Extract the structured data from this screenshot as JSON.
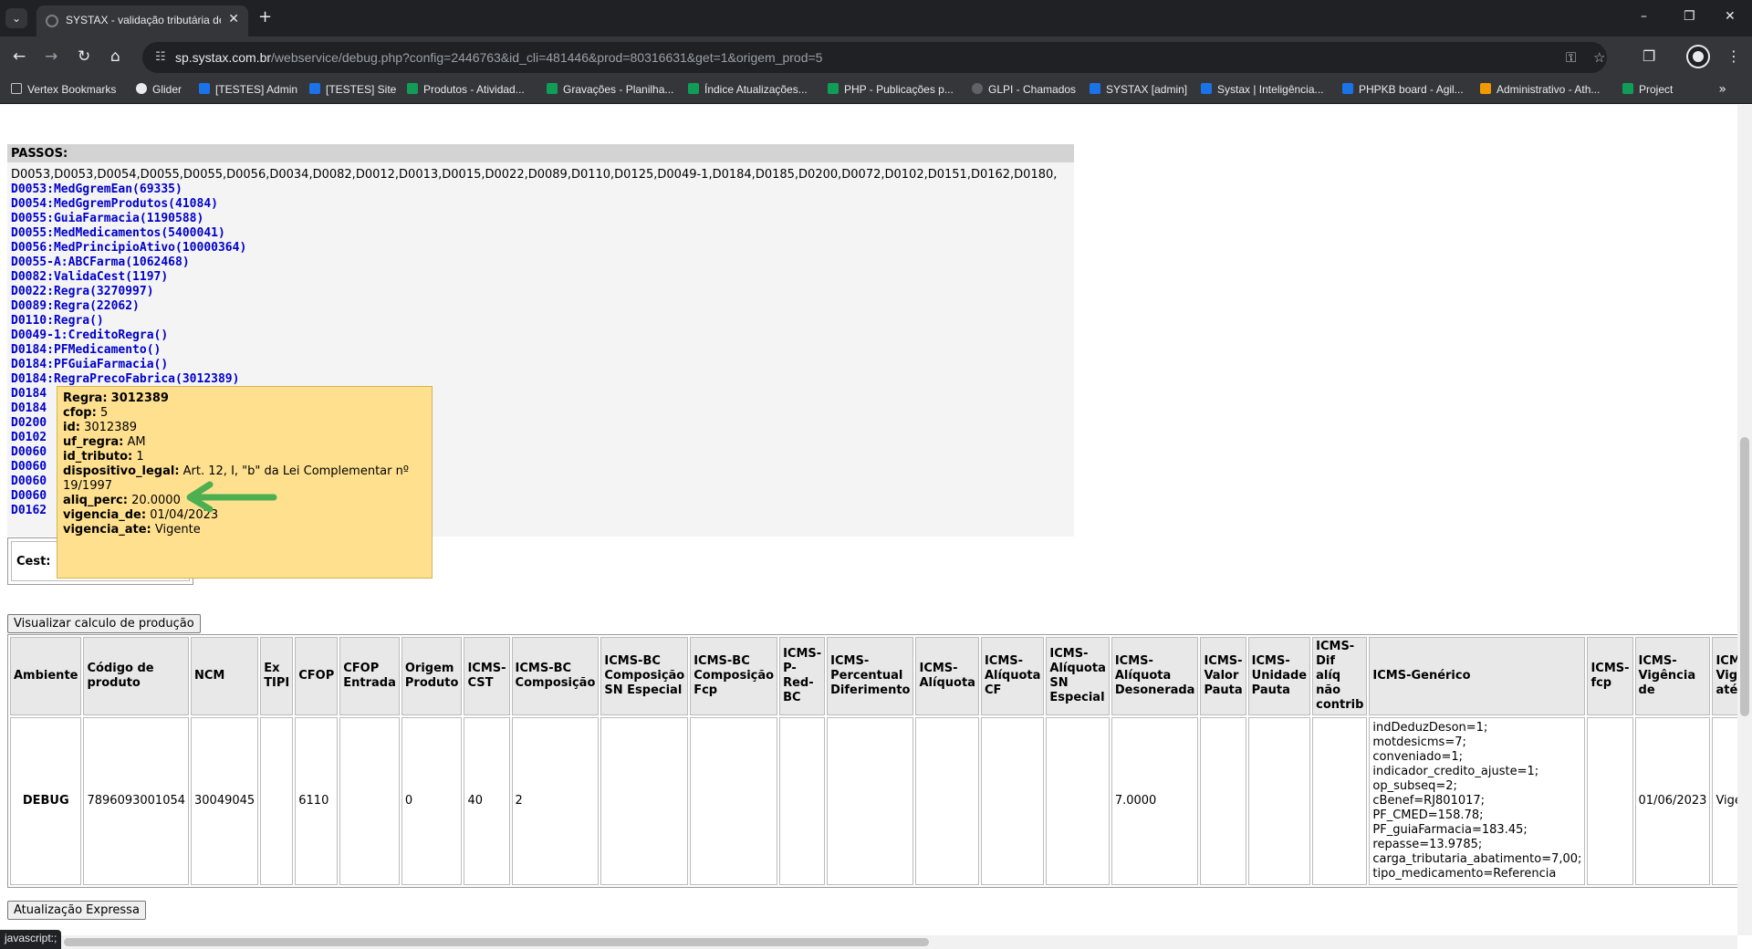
{
  "browser": {
    "tab_title": "SYSTAX - validação tributária de",
    "url_host": "sp.systax.com.br",
    "url_path": "/webservice/debug.php?config=2446763&id_cli=481446&prod=80316631&get=1&origem_prod=5",
    "status_text": "javascript:;"
  },
  "bookmarks": [
    {
      "label": "Vertex Bookmarks",
      "color": "#c4c7c5"
    },
    {
      "label": "Glider",
      "color": "#e8eaed"
    },
    {
      "label": "[TESTES] Admin",
      "color": "#1a73e8"
    },
    {
      "label": "[TESTES] Site",
      "color": "#1a73e8"
    },
    {
      "label": "Produtos - Atividad...",
      "color": "#0f9d58"
    },
    {
      "label": "Gravações - Planilha...",
      "color": "#0f9d58"
    },
    {
      "label": "Índice Atualizações...",
      "color": "#0f9d58"
    },
    {
      "label": "PHP - Publicações p...",
      "color": "#0f9d58"
    },
    {
      "label": "GLPI - Chamados",
      "color": "#5f6368"
    },
    {
      "label": "SYSTAX [admin]",
      "color": "#1a73e8"
    },
    {
      "label": "Systax | Inteligência...",
      "color": "#1a73e8"
    },
    {
      "label": "PHPKB board - Agil...",
      "color": "#1a73e8"
    },
    {
      "label": "Administrativo - Ath...",
      "color": "#f29900"
    },
    {
      "label": "Project",
      "color": "#0f9d58"
    }
  ],
  "passos": {
    "header": "PASSOS:",
    "sequence": "D0053,D0053,D0054,D0055,D0055,D0056,D0034,D0082,D0012,D0013,D0015,D0022,D0089,D0110,D0125,D0049-1,D0184,D0185,D0200,D0072,D0102,D0151,D0162,D0180,",
    "steps": [
      "D0053:MedGgremEan(69335)",
      "D0054:MedGgremProdutos(41084)",
      "D0055:GuiaFarmacia(1190588)",
      "D0055:MedMedicamentos(5400041)",
      "D0056:MedPrincipioAtivo(10000364)",
      "D0055-A:ABCFarma(1062468)",
      "D0082:ValidaCest(1197)",
      "D0022:Regra(3270997)",
      "D0089:Regra(22062)",
      "D0110:Regra()",
      "D0049-1:CreditoRegra()",
      "D0184:PFMedicamento()",
      "D0184:PFGuiaFarmacia()",
      "D0184:RegraPrecoFabrica(3012389)"
    ],
    "partial_steps": [
      "D0184",
      "D0184",
      "D0200",
      "D0102",
      "D0060",
      "D0060",
      "D0060",
      "D0060",
      "D0162"
    ]
  },
  "cest_label": "Cest:",
  "tooltip": {
    "rows": [
      {
        "key": "Regra:",
        "value": "3012389",
        "bold_value": true
      },
      {
        "key": "cfop:",
        "value": "5"
      },
      {
        "key": "id:",
        "value": "3012389"
      },
      {
        "key": "uf_regra:",
        "value": "AM"
      },
      {
        "key": "id_tributo:",
        "value": "1"
      },
      {
        "key": "dispositivo_legal:",
        "value": "Art. 12, I, \"b\" da Lei Complementar nº 19/1997"
      },
      {
        "key": "aliq_perc:",
        "value": "20.0000"
      },
      {
        "key": "vigencia_de:",
        "value": "01/04/2023"
      },
      {
        "key": "vigencia_ate:",
        "value": "Vigente"
      }
    ]
  },
  "buttons": {
    "visualizar": "Visualizar calculo de produção",
    "atualizacao": "Atualização Expressa"
  },
  "table": {
    "headers": [
      "Ambiente",
      "Código de produto",
      "NCM",
      "Ex TIPI",
      "CFOP",
      "CFOP Entrada",
      "Origem Produto",
      "ICMS-CST",
      "ICMS-BC Composição",
      "ICMS-BC Composição SN Especial",
      "ICMS-BC Composição Fcp",
      "ICMS-P-Red-BC",
      "ICMS-Percentual Diferimento",
      "ICMS-Alíquota",
      "ICMS-Alíquota CF",
      "ICMS-Alíquota SN Especial",
      "ICMS-Alíquota Desonerada",
      "ICMS-Valor Pauta",
      "ICMS-Unidade Pauta",
      "ICMS-Dif alíq não contrib",
      "ICMS-Genérico",
      "ICMS-fcp",
      "ICMS-Vigência de",
      "ICMS-Vigência até"
    ],
    "row": [
      "DEBUG",
      "7896093001054",
      "30049045",
      "",
      "6110",
      "",
      "0",
      "40",
      "2",
      "",
      "",
      "",
      "",
      "",
      "",
      "",
      "7.0000",
      "",
      "",
      "",
      "",
      "",
      "01/06/2023",
      "Vigente"
    ],
    "generico": [
      "indDeduzDeson=1;",
      "motdesicms=7;",
      "conveniado=1;",
      "indicador_credito_ajuste=1;",
      "op_subseq=2;",
      "cBenef=RJ801017;",
      "PF_CMED=158.78;",
      "PF_guiaFarmacia=183.45;",
      "repasse=13.9785;",
      "carga_tributaria_abatimento=7,00;",
      "tipo_medicamento=Referencia"
    ]
  }
}
